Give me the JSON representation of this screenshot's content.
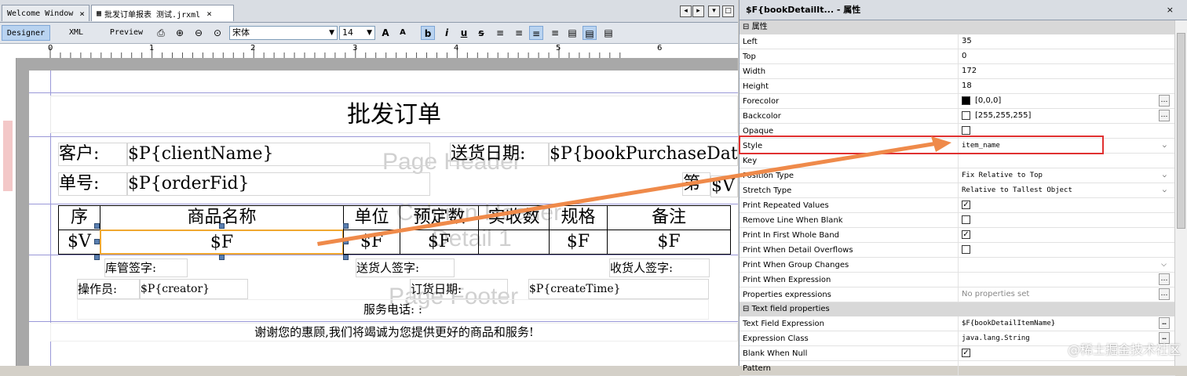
{
  "tabs": [
    {
      "label": "Welcome Window",
      "close": "×"
    },
    {
      "label": "批发订单报表 测试.jrxml",
      "close": "×"
    }
  ],
  "view_buttons": [
    "Designer",
    "XML",
    "Preview"
  ],
  "toolbar": {
    "font_name": "宋体",
    "font_size": "14",
    "icons": [
      "print-icon",
      "zoom-in-icon",
      "zoom-out-icon",
      "font-increase-icon",
      "font-decrease-icon",
      "bold-icon",
      "italic-icon",
      "underline-icon",
      "strikethrough-icon",
      "align-left-icon",
      "align-justify-icon",
      "align-center-icon",
      "align-right-icon",
      "vertical-top-icon",
      "vertical-middle-icon",
      "vertical-bottom-icon"
    ]
  },
  "ruler_marks": [
    "0",
    "1",
    "2",
    "3",
    "4",
    "5",
    "6"
  ],
  "report": {
    "title": "批发订单",
    "client_label": "客户:",
    "client_value": "$P{clientName}",
    "date_label": "送货日期:",
    "date_value": "$P{bookPurchaseDate",
    "order_label": "单号:",
    "order_value": "$P{orderFid}",
    "page_label": "第",
    "page_value": "$V",
    "band_page_header": "Page Header",
    "band_column_header": "Column Header",
    "band_detail": "Detail 1",
    "band_page_footer": "Page Footer",
    "headers": [
      "序",
      "商品名称",
      "单位",
      "预定数",
      "实收数",
      "规格",
      "备注"
    ],
    "detail": [
      "$V",
      "$F",
      "$F",
      "$F",
      "",
      "$F",
      "$F"
    ],
    "warehouse_sign": "库管签字:",
    "deliverer_sign": "送货人签字:",
    "receiver_sign": "收货人签字:",
    "operator_label": "操作员:",
    "operator_value": "$P{creator}",
    "order_date_label": "订货日期:",
    "order_date_value": "$P{createTime}",
    "service_phone": "服务电话: :",
    "thanks": "谢谢您的惠顾,我们将竭诚为您提供更好的商品和服务!"
  },
  "props": {
    "title": "$F{bookDetailIt... - 属性",
    "close": "×",
    "cat_general": "属性",
    "cat_text": "Text field properties",
    "rows": [
      {
        "name": "Left",
        "value": "35"
      },
      {
        "name": "Top",
        "value": "0"
      },
      {
        "name": "Width",
        "value": "172"
      },
      {
        "name": "Height",
        "value": "18"
      },
      {
        "name": "Forecolor",
        "value": "[0,0,0]"
      },
      {
        "name": "Backcolor",
        "value": "[255,255,255]"
      },
      {
        "name": "Opaque",
        "value": ""
      },
      {
        "name": "Style",
        "value": "item_name"
      },
      {
        "name": "Key",
        "value": ""
      },
      {
        "name": "Position Type",
        "value": "Fix Relative to Top"
      },
      {
        "name": "Stretch Type",
        "value": "Relative to Tallest Object"
      },
      {
        "name": "Print Repeated Values",
        "value": ""
      },
      {
        "name": "Remove Line When Blank",
        "value": ""
      },
      {
        "name": "Print In First Whole Band",
        "value": ""
      },
      {
        "name": "Print When Detail Overflows",
        "value": ""
      },
      {
        "name": "Print When Group Changes",
        "value": ""
      },
      {
        "name": "Print When Expression",
        "value": ""
      },
      {
        "name": "Properties expressions",
        "value": "No properties set"
      }
    ],
    "text_rows": [
      {
        "name": "Text Field Expression",
        "value": "$F{bookDetailItemName}"
      },
      {
        "name": "Expression Class",
        "value": "java.lang.String"
      },
      {
        "name": "Blank When Null",
        "value": ""
      },
      {
        "name": "Pattern",
        "value": ""
      }
    ],
    "checked": {
      "Opaque": false,
      "Print Repeated Values": true,
      "Remove Line When Blank": false,
      "Print In First Whole Band": true,
      "Print When Detail Overflows": false,
      "Blank When Null": true
    },
    "forecolor_hex": "#000000",
    "backcolor_hex": "#ffffff"
  },
  "watermark": "@稀土掘金技术社区",
  "colors": {
    "highlight": "#e03030",
    "arrow": "#ef8a4a",
    "selection": "#f0a830"
  }
}
